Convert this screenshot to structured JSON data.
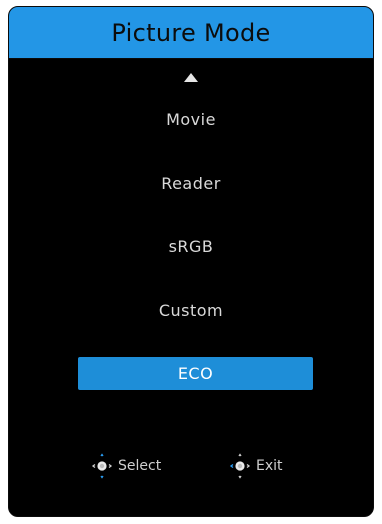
{
  "osd": {
    "title": "Picture Mode",
    "menu_items": [
      "Movie",
      "Reader",
      "sRGB",
      "Custom",
      "ECO"
    ],
    "selected_index": 4
  },
  "hints": {
    "select_label": "Select",
    "select_icon": "joystick-left-right-icon",
    "exit_label": "Exit",
    "exit_icon": "joystick-left-icon"
  },
  "colors": {
    "title_bar": "#2396e6",
    "selected_item": "#1e8ed8",
    "background": "#000000",
    "text": "#d9d9d9",
    "joystick_accent": "#2a9df4"
  }
}
